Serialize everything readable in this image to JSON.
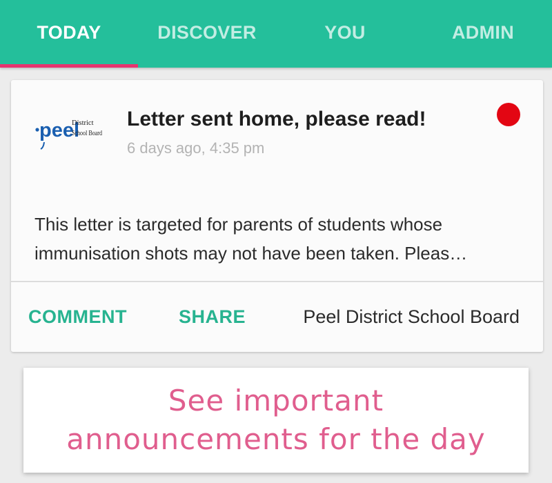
{
  "tabs": [
    {
      "label": "TODAY",
      "active": true
    },
    {
      "label": "DISCOVER",
      "active": false
    },
    {
      "label": "YOU",
      "active": false
    },
    {
      "label": "ADMIN",
      "active": false
    }
  ],
  "colors": {
    "tabbar": "#24bf9b",
    "indicator": "#e8336f",
    "action": "#27b390",
    "unread": "#e30613",
    "caption": "#e05e8e"
  },
  "announcement": {
    "logo": {
      "word": "peel",
      "line1": "District",
      "line2": "School Board"
    },
    "title": "Letter sent home, please read!",
    "time": "6 days ago, 4:35 pm",
    "unread_icon": "red-dot-icon",
    "body_line1": "This letter is targeted for parents of students whose",
    "body_line2": "immunisation shots may not have been taken. Pleas…",
    "comment_label": "COMMENT",
    "share_label": "SHARE",
    "source": "Peel District School Board"
  },
  "caption": {
    "line1": "See important",
    "line2": "announcements for the day"
  }
}
